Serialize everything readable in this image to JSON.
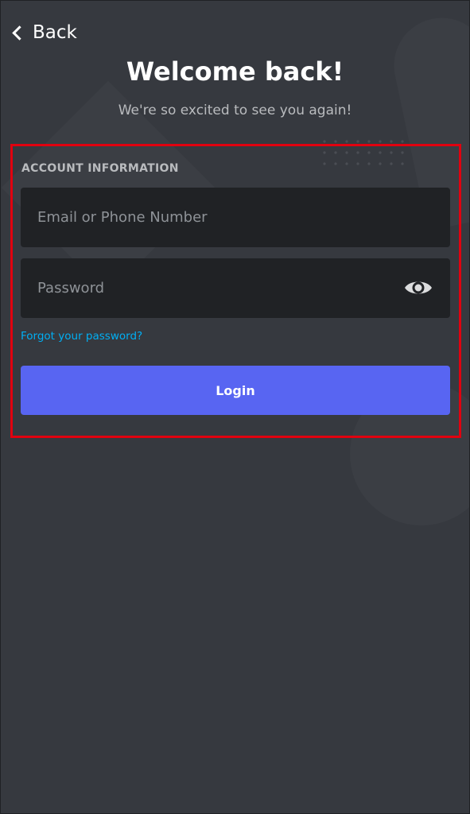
{
  "nav": {
    "back_label": "Back"
  },
  "header": {
    "title": "Welcome back!",
    "subtitle": "We're so excited to see you again!"
  },
  "form": {
    "section_label": "ACCOUNT INFORMATION",
    "email": {
      "value": "",
      "placeholder": "Email or Phone Number"
    },
    "password": {
      "value": "",
      "placeholder": "Password"
    },
    "forgot_label": "Forgot your password?",
    "login_label": "Login"
  },
  "icons": {
    "back": "chevron-left-icon",
    "show_password": "eye-icon"
  },
  "colors": {
    "background": "#36393f",
    "input_background": "#202225",
    "accent": "#5865f2",
    "link": "#00aff4",
    "highlight": "#e1000f",
    "muted_text": "#b9bbbe"
  }
}
